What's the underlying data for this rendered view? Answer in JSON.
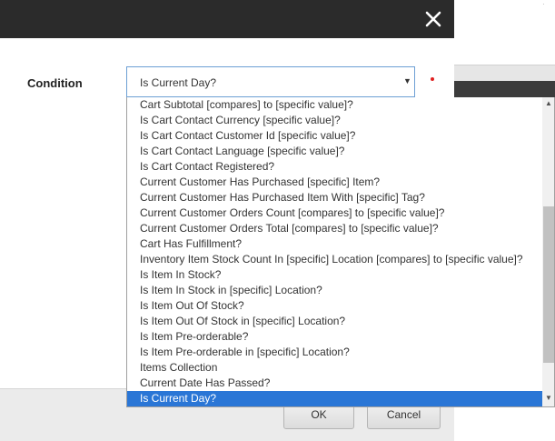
{
  "dialog": {
    "close_icon": "close-icon",
    "condition_label": "Condition",
    "select_value": "Is Current Day?",
    "required_color": "#e02020",
    "ok_label": "OK",
    "cancel_label": "Cancel"
  },
  "dropdown": {
    "options": [
      "Cart Subtotal [compares] to [specific value]?",
      "Is Cart Contact Currency [specific value]?",
      "Is Cart Contact Customer Id [specific value]?",
      "Is Cart Contact Language [specific value]?",
      "Is Cart Contact Registered?",
      "Current Customer Has Purchased [specific] Item?",
      "Current Customer Has Purchased Item With [specific] Tag?",
      "Current Customer Orders Count [compares] to [specific value]?",
      "Current Customer Orders Total [compares] to [specific value]?",
      "Cart Has Fulfillment?",
      "Inventory Item Stock Count In [specific] Location [compares] to [specific value]?",
      "Is Item In Stock?",
      "Is Item In Stock in [specific] Location?",
      "Is Item Out Of Stock?",
      "Is Item Out Of Stock in [specific] Location?",
      "Is Item Pre-orderable?",
      "Is Item Pre-orderable in [specific] Location?",
      "Items Collection",
      "Current Date Has Passed?",
      "Is Current Day?"
    ],
    "selected": "Is Current Day?",
    "highlight_color": "#2a76d6"
  }
}
